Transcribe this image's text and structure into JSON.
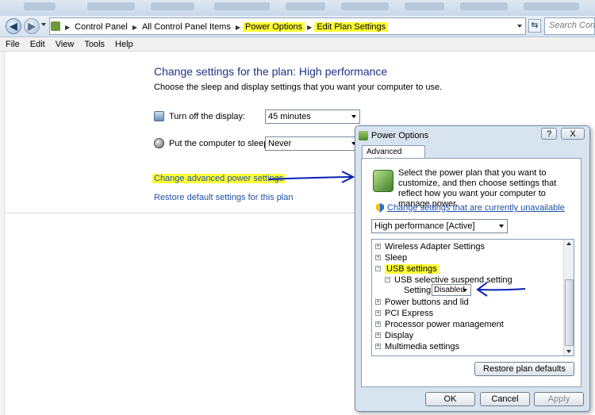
{
  "breadcrumb": [
    "Control Panel",
    "All Control Panel Items",
    "Power Options",
    "Edit Plan Settings"
  ],
  "search_placeholder": "Search Control",
  "menu": [
    "File",
    "Edit",
    "View",
    "Tools",
    "Help"
  ],
  "main": {
    "title": "Change settings for the plan: High performance",
    "subtitle": "Choose the sleep and display settings that you want your computer to use.",
    "display_label": "Turn off the display:",
    "display_value": "45 minutes",
    "sleep_label": "Put the computer to sleep:",
    "sleep_value": "Never",
    "advanced_link": "Change advanced power settings",
    "restore_link": "Restore default settings for this plan"
  },
  "dialog": {
    "title": "Power Options",
    "help_label": "?",
    "close_label": "X",
    "tab": "Advanced settings",
    "description": "Select the power plan that you want to customize, and then choose settings that reflect how you want your computer to manage power.",
    "unavailable_link": "Change settings that are currently unavailable",
    "plan_value": "High performance [Active]",
    "tree": [
      {
        "box": "+",
        "label": "Wireless Adapter Settings"
      },
      {
        "box": "+",
        "label": "Sleep"
      },
      {
        "box": "−",
        "label": "USB settings"
      },
      {
        "box": "−",
        "label": "USB selective suspend setting"
      },
      {
        "box": "",
        "label": "Setting:"
      },
      {
        "box": "+",
        "label": "Power buttons and lid"
      },
      {
        "box": "+",
        "label": "PCI Express"
      },
      {
        "box": "+",
        "label": "Processor power management"
      },
      {
        "box": "+",
        "label": "Display"
      },
      {
        "box": "+",
        "label": "Multimedia settings"
      }
    ],
    "setting_value": "Disabled",
    "restore_button": "Restore plan defaults",
    "ok_button": "OK",
    "cancel_button": "Cancel",
    "apply_button": "Apply"
  },
  "colors": {
    "highlight": "#ffff37",
    "link": "#1e4fa6",
    "title": "#1e3287",
    "annotation_arrow": "#0a1fb8"
  }
}
